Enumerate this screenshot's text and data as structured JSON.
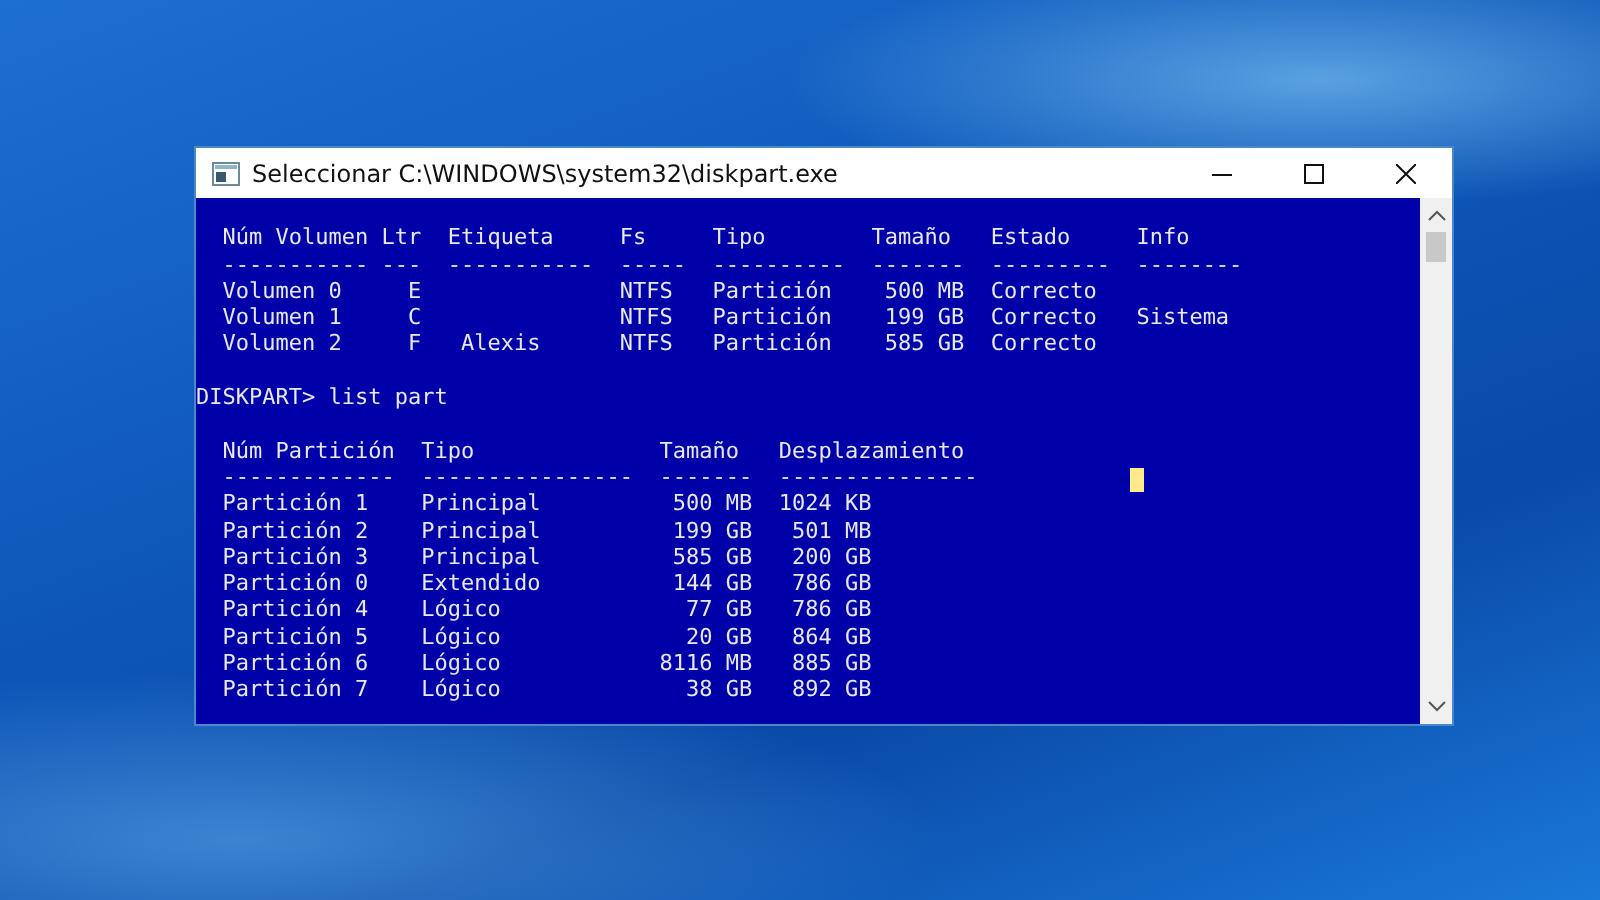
{
  "window": {
    "title": "Seleccionar C:\\WINDOWS\\system32\\diskpart.exe"
  },
  "console": {
    "blocks": [
      [
        "  Núm Volumen Ltr  Etiqueta     Fs     Tipo        Tamaño   Estado     Info",
        "  ----------- ---  -----------  -----  ----------  -------  ---------  --------",
        "  Volumen 0     E               NTFS   Partición    500 MB  Correcto",
        "  Volumen 1     C               NTFS   Partición    199 GB  Correcto   Sistema",
        "  Volumen 2     F   Alexis      NTFS   Partición    585 GB  Correcto"
      ],
      [
        "DISKPART> list part"
      ],
      [
        "  Núm Partición  Tipo              Tamaño   Desplazamiento",
        "  -------------  ----------------  -------  ---------------",
        "  Partición 1    Principal          500 MB  1024 KB",
        "  Partición 2    Principal          199 GB   501 MB",
        "  Partición 3    Principal          585 GB   200 GB",
        "  Partición 0    Extendido          144 GB   786 GB",
        "  Partición 4    Lógico              77 GB   786 GB",
        "  Partición 5    Lógico              20 GB   864 GB",
        "  Partición 6    Lógico            8116 MB   885 GB",
        "  Partición 7    Lógico              38 GB   892 GB"
      ]
    ]
  }
}
